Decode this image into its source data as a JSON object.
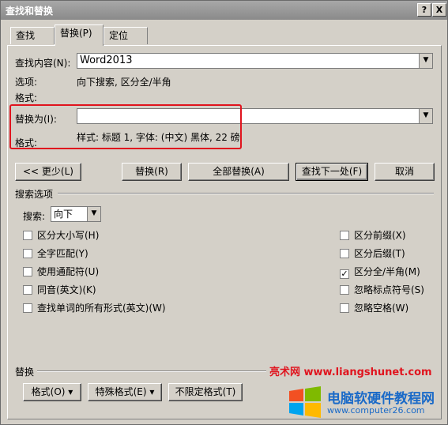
{
  "window": {
    "title": "查找和替换",
    "help_btn": "?",
    "close_btn": "X"
  },
  "tabs": [
    {
      "label": "查找(D)"
    },
    {
      "label": "替换(P)"
    },
    {
      "label": "定位(G)"
    }
  ],
  "find": {
    "label": "查找内容(N):",
    "value": "Word2013",
    "options_label": "选项:",
    "options_value": "向下搜索, 区分全/半角",
    "format_label": "格式:"
  },
  "replace": {
    "label": "替换为(I):",
    "value": "",
    "format_label": "格式:",
    "format_value": "样式: 标题 1, 字体: (中文) 黑体, 22 磅"
  },
  "buttons": {
    "less": "<< 更少(L)",
    "replace": "替换(R)",
    "replace_all": "全部替换(A)",
    "find_next": "查找下一处(F)",
    "cancel": "取消"
  },
  "search_options": {
    "section_label": "搜索选项",
    "search_label": "搜索:",
    "search_value": "向下",
    "left": [
      {
        "label": "区分大小写(H)",
        "checked": false
      },
      {
        "label": "全字匹配(Y)",
        "checked": false
      },
      {
        "label": "使用通配符(U)",
        "checked": false
      },
      {
        "label": "同音(英文)(K)",
        "checked": false
      },
      {
        "label": "查找单词的所有形式(英文)(W)",
        "checked": false
      }
    ],
    "right": [
      {
        "label": "区分前缀(X)",
        "checked": false
      },
      {
        "label": "区分后缀(T)",
        "checked": false
      },
      {
        "label": "区分全/半角(M)",
        "checked": true
      },
      {
        "label": "忽略标点符号(S)",
        "checked": false
      },
      {
        "label": "忽略空格(W)",
        "checked": false
      }
    ]
  },
  "replace_section": {
    "label": "替换",
    "format_btn": "格式(O)",
    "special_btn": "特殊格式(E)",
    "no_format_btn": "不限定格式(T)"
  },
  "watermark": {
    "line1": "亮术网 www.liangshunet.com",
    "line2": "电脑软硬件教程网",
    "line3": "www.computer26.com"
  },
  "colors": {
    "highlight": "#e0141e",
    "brand_blue": "#1a6ac8"
  }
}
